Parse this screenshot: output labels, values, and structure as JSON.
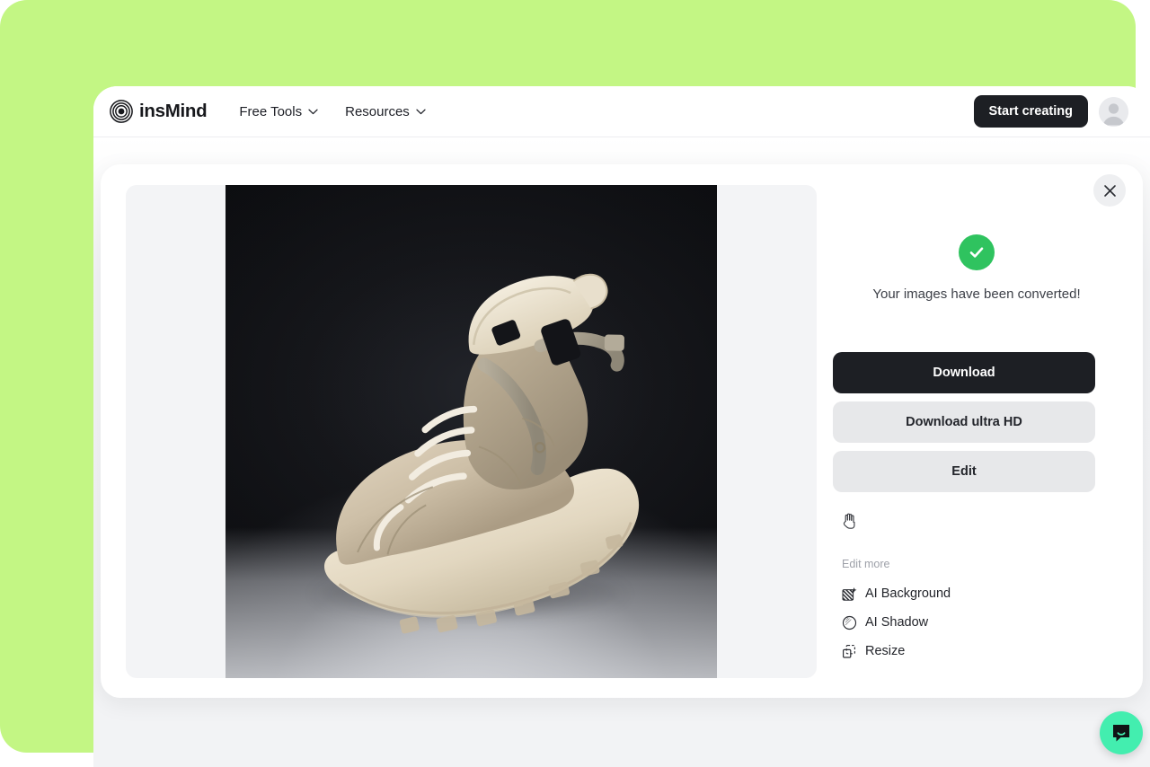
{
  "theme": {
    "backdrop_green": "#c3f684",
    "accent_dark": "#1d1f24",
    "success_green": "#2fc35f",
    "chat_mint": "#43eeaf",
    "panel_gray": "#f3f4f6",
    "button_gray": "#e7e8ea"
  },
  "header": {
    "brand_name": "insMind",
    "brand_logo_icon": "concentric-circles-logo",
    "nav": [
      {
        "label": "Free Tools",
        "icon": "chevron-down-icon"
      },
      {
        "label": "Resources",
        "icon": "chevron-down-icon"
      }
    ],
    "cta_label": "Start creating",
    "avatar_icon": "default-user-avatar"
  },
  "modal": {
    "close_icon": "close-icon",
    "preview": {
      "image_alt": "beige high-top sneaker boot on dark studio background",
      "background_removed": false
    },
    "status": {
      "icon": "check-circle-icon",
      "message": "Your images have been converted!"
    },
    "actions": [
      {
        "label": "Download",
        "style": "primary",
        "name": "download-button"
      },
      {
        "label": "Download ultra HD",
        "style": "secondary",
        "name": "download-ultra-hd-button"
      },
      {
        "label": "Edit",
        "style": "secondary",
        "name": "edit-button"
      }
    ],
    "tool_cursor_icon": "grab-hand-icon",
    "edit_more": {
      "label": "Edit more",
      "items": [
        {
          "label": "AI Background",
          "icon": "ai-background-icon"
        },
        {
          "label": "AI Shadow",
          "icon": "ai-shadow-icon"
        },
        {
          "label": "Resize",
          "icon": "resize-icon"
        }
      ]
    }
  },
  "chat": {
    "icon": "chat-bubble-icon",
    "aria_label": "Open chat"
  }
}
